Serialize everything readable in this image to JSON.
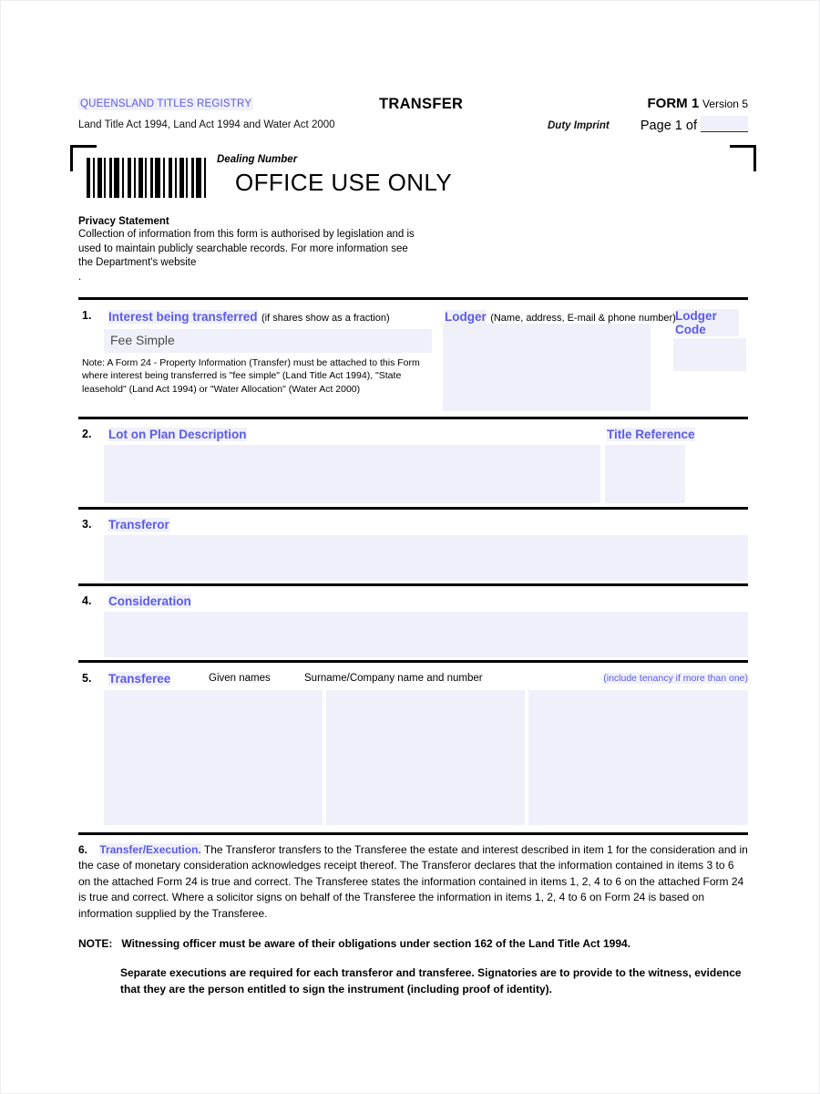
{
  "header": {
    "registry": "QUEENSLAND TITLES REGISTRY",
    "acts": "Land Title Act 1994, Land Act 1994 and Water Act 2000",
    "title": "TRANSFER",
    "duty_imprint": "Duty Imprint",
    "form_label": "FORM 1",
    "version_label": "Version 5",
    "page_of": "Page 1 of",
    "colors": {
      "heading_blue": "#5b5bea",
      "field_fill": "#f0f0fa",
      "rule": "#000000"
    }
  },
  "office_block": {
    "dealing_number_label": "Dealing Number",
    "office_use_text": "OFFICE USE ONLY",
    "barcode_icon": "barcode-icon"
  },
  "privacy": {
    "heading": "Privacy Statement",
    "body": "Collection of information from this form is authorised by legislation and is used to maintain publicly searchable records. For more information see the Department's website",
    "trailing_mark": "."
  },
  "section1": {
    "number": "1.",
    "heading": "Interest being transferred",
    "heading_note": "(if shares show as a fraction)",
    "interest_value": "Fee Simple",
    "note": "Note: A Form 24 - Property Information (Transfer) must be attached to this Form where interest being transferred is \"fee simple\" (Land Title Act 1994),  \"State leasehold\" (Land Act 1994) or \"Water Allocation\" (Water Act 2000)",
    "lodger_heading": "Lodger",
    "lodger_note": "(Name, address, E-mail & phone number)",
    "lodger_value": "",
    "lodger_code_heading": "Lodger Code",
    "lodger_code_value": ""
  },
  "section2": {
    "number": "2.",
    "heading": "Lot on Plan Description",
    "value": "",
    "title_reference_heading": "Title Reference",
    "title_reference_value": ""
  },
  "section3": {
    "number": "3.",
    "heading": "Transferor",
    "value": ""
  },
  "section4": {
    "number": "4.",
    "heading": "Consideration",
    "value": ""
  },
  "section5": {
    "number": "5.",
    "heading": "Transferee",
    "col_given_names": "Given names",
    "col_surname": "Surname/Company name and number",
    "tenancy_note": "(include tenancy if more than one)",
    "given_names_value": "",
    "surname_value": "",
    "tenancy_value": ""
  },
  "section6": {
    "number": "6.",
    "heading": "Transfer/Execution.",
    "body": "The Transferor transfers to the Transferee the estate and interest described in item 1 for the consideration and in the case of monetary consideration acknowledges receipt thereof.  The Transferor declares that the information contained in items 3 to 6 on the attached Form 24 is true and correct.  The Transferee states the information contained in items 1, 2, 4 to 6 on the attached Form 24 is true and correct.  Where a solicitor signs on behalf of the Transferee the information in items 1, 2, 4 to 6 on Form 24 is based on information supplied by the Transferee."
  },
  "notes": {
    "label": "NOTE:",
    "line1": "Witnessing officer must be aware of their obligations under section 162 of the Land Title Act 1994.",
    "line2": "Separate executions are required for each transferor and transferee.  Signatories are to provide to the witness, evidence that they are the person entitled to sign the instrument (including proof of identity)."
  }
}
